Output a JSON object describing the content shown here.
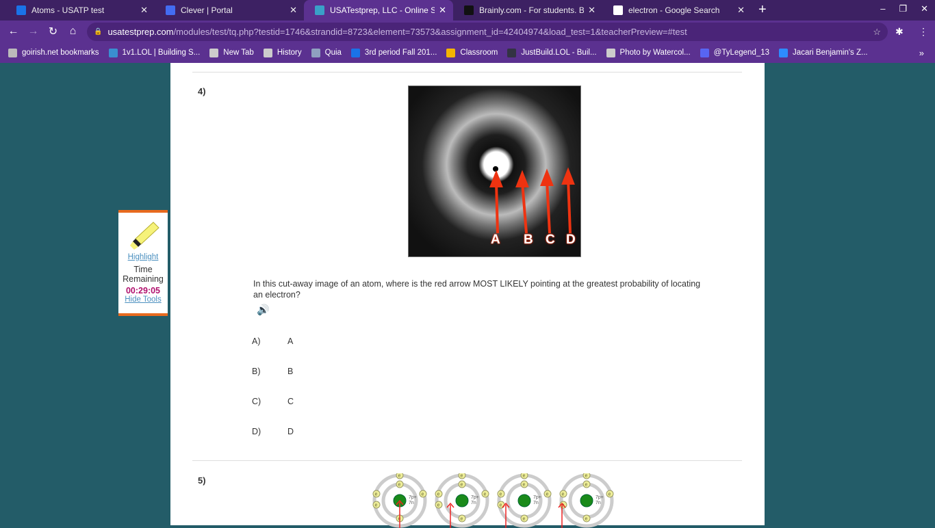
{
  "browser": {
    "tabs": [
      {
        "title": "Atoms - USATP test",
        "icon": "classroom-icon",
        "color": "#1a73e8"
      },
      {
        "title": "Clever | Portal",
        "icon": "clever-icon",
        "color": "#436cf2"
      },
      {
        "title": "USATestprep, LLC - Online State-",
        "icon": "usatestprep-icon",
        "color": "#3aa0c8",
        "active": true
      },
      {
        "title": "Brainly.com - For students. By st",
        "icon": "brainly-icon",
        "color": "#111"
      },
      {
        "title": "electron - Google Search",
        "icon": "google-icon",
        "color": "#fff"
      }
    ],
    "url_host": "usatestprep.com",
    "url_path": "/modules/test/tq.php?testid=1746&strandid=8723&element=73573&assignment_id=42404974&load_test=1&teacherPreview=#test",
    "bookmarks": [
      "goirish.net bookmarks",
      "1v1.LOL | Building S...",
      "New Tab",
      "History",
      "Quia",
      "3rd period Fall 201...",
      "Classroom",
      "JustBuild.LOL - Buil...",
      "Photo by Watercol...",
      "@TyLegend_13",
      "Jacari Benjamin's Z..."
    ]
  },
  "tools": {
    "highlight": "Highlight",
    "time_label_1": "Time",
    "time_label_2": "Remaining",
    "time": "00:29:05",
    "hide": "Hide Tools"
  },
  "question4": {
    "number": "4)",
    "image_labels": [
      "A",
      "B",
      "C",
      "D"
    ],
    "text": "In this cut-away image of an atom, where is the red arrow MOST LIKELY pointing at the greatest probability of locating an electron?",
    "choices": [
      {
        "key": "A)",
        "value": "A"
      },
      {
        "key": "B)",
        "value": "B"
      },
      {
        "key": "C)",
        "value": "C"
      },
      {
        "key": "D)",
        "value": "D"
      }
    ]
  },
  "question5": {
    "number": "5)",
    "nucleus_label_1": "7p+",
    "nucleus_label_2": "7n",
    "electron_label": "e"
  }
}
